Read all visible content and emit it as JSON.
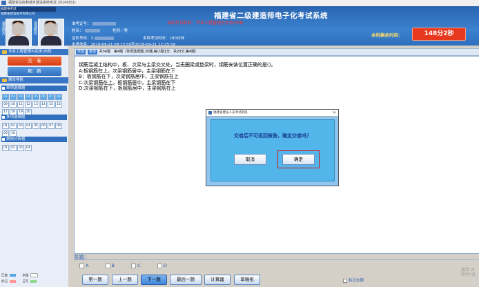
{
  "window": {
    "title": "福建省住房和城乡建设系统考试 2014(001)"
  },
  "header": {
    "company_line1": "福建省考试",
    "company_line2": "福建省建设技术有限公司",
    "photo_label_left": "报名照片",
    "photo_label_right": "现场照片",
    "exam_title": "福建省二级建造师电子化考试系统",
    "subject": "当前考试科目：专业工程管理与实务(市政",
    "exam_no_label": "准考证号：",
    "name_label": "姓名：",
    "gender_label": "性别：",
    "gender": "男",
    "id_label": "证件号码：",
    "id_value": "3",
    "duration_label": "本科考试时长：",
    "duration": "180分钟",
    "schedule_label": "本场信息：",
    "schedule": "2019-09-21 09:15:59至2019-09-21 12:25:59",
    "time_left_label": "本科剩余时间：",
    "time_left": "148分2秒"
  },
  "sidebar": {
    "subject_head": "专业工程管理与实务(市政",
    "submit": "交　卷",
    "refresh": "刷　新",
    "nav_head": "题目导航",
    "sections": [
      {
        "title": "单项选择题",
        "items": [
          "01",
          "02",
          "03",
          "04",
          "05",
          "06",
          "07",
          "08",
          "09",
          "10",
          "11",
          "12",
          "13",
          "14",
          "15",
          "16",
          "17",
          "18",
          "19",
          "20"
        ],
        "answered": [
          "01",
          "02",
          "03",
          "04",
          "05",
          "06",
          "07",
          "08"
        ]
      },
      {
        "title": "多项选择题",
        "items": [
          "01",
          "02",
          "03",
          "04",
          "05",
          "06",
          "07",
          "08",
          "09",
          "10"
        ],
        "answered": []
      },
      {
        "title": "案例分析题",
        "items": [
          "01",
          "02",
          "03",
          "04"
        ],
        "answered": []
      }
    ],
    "legend": {
      "done": "已做",
      "undone": "未做",
      "marked": "标记",
      "current": "已写"
    },
    "colors": {
      "done": "#53a5e8",
      "undone": "#ffffff",
      "marked": "#ff9999",
      "current": "#8fd68f"
    }
  },
  "main": {
    "tab1": "单选",
    "tab2": "复选",
    "info": "共34题　第4题（单项选择题:20题,每小题1分，共20分,第4题）",
    "question": "钢筋混凝土结构中，板、次梁与主梁交叉处，当无圈梁或垫梁时，钢筋安装位置正确的是()。",
    "options": [
      "A:板钢筋在上，次梁钢筋居中，主梁钢筋在下",
      "B：板钢筋在下，次梁钢筋居中，主梁钢筋在上",
      "C:次梁钢筋在上，板钢筋居中，主梁钢筋在下",
      "D:次梁钢筋在下，板钢筋居中，主梁钢筋在上"
    ],
    "answer_label": "答题：",
    "answer_choices": [
      "A",
      "B",
      "C",
      "D"
    ],
    "buttons": {
      "first": "第一题",
      "prev": "上一题",
      "next": "下一题",
      "last": "最后一题",
      "calc": "计算器",
      "draft": "草稿纸"
    },
    "mark_label": "标记本题",
    "watermark": "激活 W 转到\"设"
  },
  "dialog": {
    "title": "福建省建设人员考试系统",
    "message": "交卷后不可返回做答，确定交卷吗？",
    "cancel": "取消",
    "ok": "确定"
  }
}
